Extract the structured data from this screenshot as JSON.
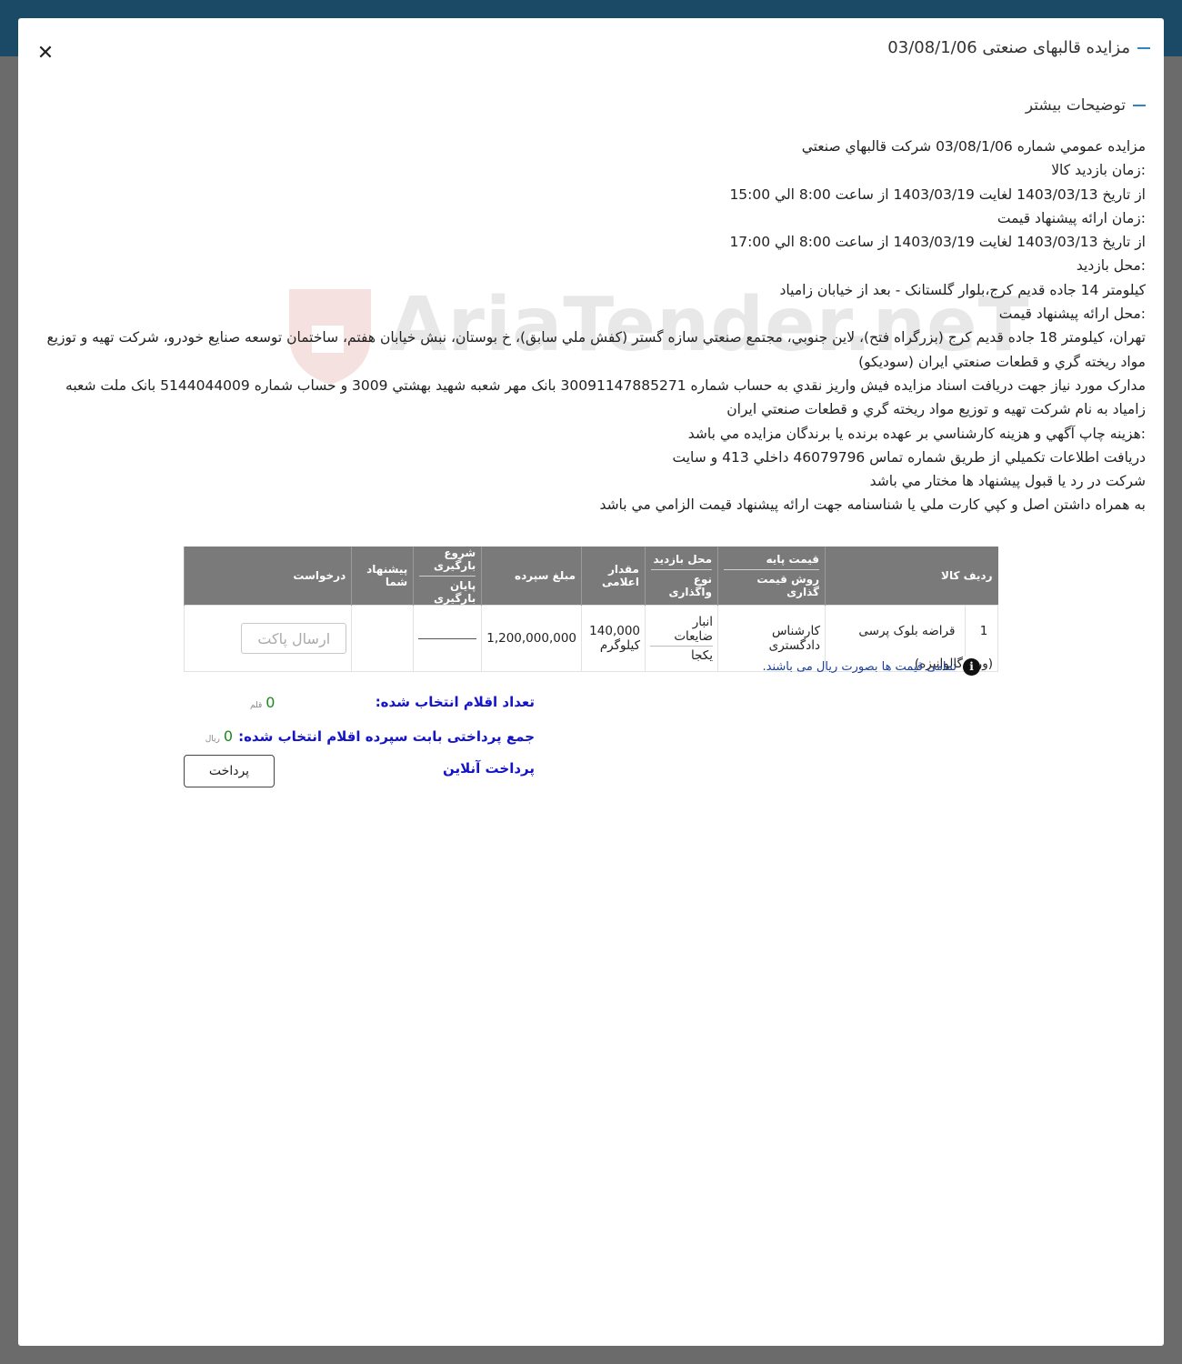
{
  "modal": {
    "title": "مزایده قالبهای صنعتی 03/08/1/06",
    "close_icon": "close-icon"
  },
  "section": {
    "title": "توضیحات بیشتر"
  },
  "description": [
    "مزايده عمومي شماره 03/08/1/06 شركت قالبهاي صنعتي",
    ":زمان بازدید کالا",
    "از تاریخ 1403/03/13 لغایت 1403/03/19 از ساعت 8:00 الي 15:00",
    ":زمان ارائه پیشنهاد قیمت",
    "از تاریخ 1403/03/13 لغایت 1403/03/19 از ساعت 8:00 الي 17:00",
    ":محل بازدید",
    "كيلومتر 14 جاده قديم كرج،بلوار گلستانک - بعد از خيابان زامياد",
    ":محل ارائه پیشنهاد قیمت",
    "تهران، كيلومتر 18 جاده قديم كرج (بزرگراه فتح)، لاين جنوبي، مجتمع صنعتي سازه گستر (كفش ملي سابق)، خ بوستان، نبش خيابان هفتم، ساختمان توسعه صنايع خودرو، شركت تهيه و توزيع مواد ريخته گري و قطعات صنعتي ايران (سوديكو)",
    "مدارک مورد نیاز جهت دریافت اسناد مزايده فيش واريز نقدي به حساب شماره 30091147885271 بانک مهر شعبه شهيد بهشتي 3009 و حساب شماره 5144044009 بانک ملت شعبه زامياد به نام شركت تهيه و توزيع مواد ريخته گري و قطعات صنعتي ايران",
    ":هزینه چاپ آگهي و هزينه كارشناسي بر عهده برنده يا برندگان مزايده مي باشد",
    "دريافت اطلاعات تكميلي از طريق شماره تماس 46079796 داخلي 413 و سايت",
    "شرکت در رد یا قبول پیشنهاد ها مختار مي باشد",
    "به همراه داشتن اصل و كپي كارت ملي يا شناسنامه جهت ارائه پيشنهاد قيمت الزامي مي باشد"
  ],
  "watermark": {
    "text": "AriaTender.neT",
    "icon": "shield-hand-logo-icon"
  },
  "table": {
    "headers": {
      "row_item": "ردیف کالا",
      "base_price": "قیمت پایه",
      "pricing_method": "روش قیمت گذاری",
      "visit_place": "محل بازدید",
      "assign_type": "نوع واگذاری",
      "quantity": "مقدار اعلامی",
      "deposit": "مبلغ سپرده",
      "load_start": "شروع بارگیری",
      "load_end": "پایان بارگیری",
      "your_offer": "پیشنهاد شما",
      "request": "درخواست"
    },
    "rows": [
      {
        "num": "1",
        "item": "قراضه بلوک پرسی (ورق گالوانیزه)",
        "base_price": "کارشناس دادگستری",
        "visit_place": "انبار ضایعات",
        "assign_type": "یکجا",
        "quantity": "140,000",
        "unit": "کیلوگرم",
        "deposit": "1,200,000,000",
        "request_button": "ارسال پاکت"
      }
    ]
  },
  "note": {
    "icon": "info-icon",
    "text": "تمامی قیمت ها بصورت ریال می باشند."
  },
  "summary": {
    "count_label": "تعداد اقلام انتخاب شده:",
    "count_value": "0",
    "count_unit": "قلم",
    "total_label": "جمع پرداختی بابت سپرده اقلام انتخاب شده:",
    "total_value": "0",
    "total_unit": "ریال",
    "online_label": "پرداخت آنلاین",
    "pay_button": "پرداخت"
  },
  "colors": {
    "topbar": "#1b4a66",
    "accent_dash": "#2a86c8",
    "table_header": "#7a7a7a",
    "summary_label": "#1414c8",
    "summary_value": "#1a8a1a",
    "note_text": "#1b3f9e"
  }
}
